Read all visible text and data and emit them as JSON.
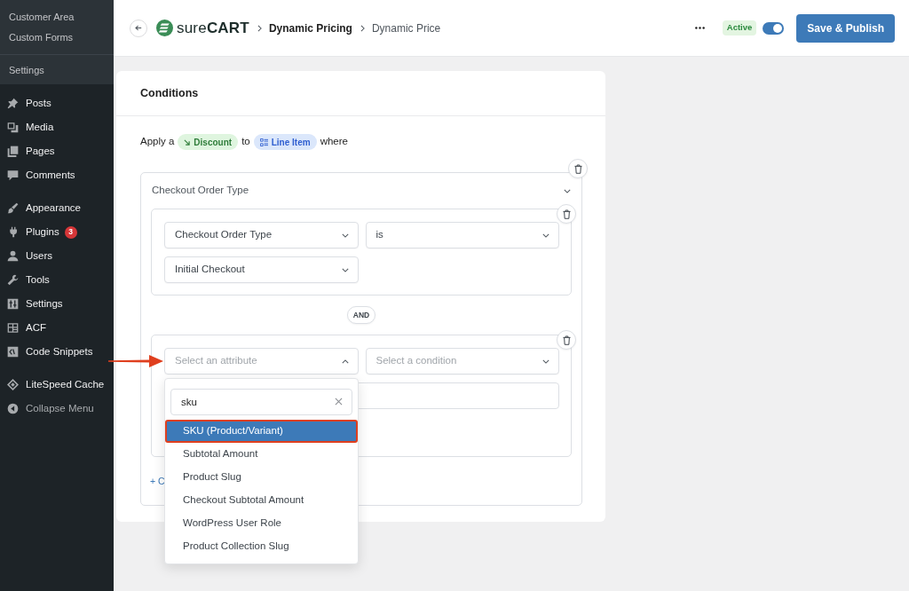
{
  "sidebar": {
    "submenu_groups": [
      {
        "items": [
          {
            "label": "Customer Area"
          },
          {
            "label": "Custom Forms"
          }
        ]
      },
      {
        "items": [
          {
            "label": "Settings"
          }
        ]
      }
    ],
    "menu_groups": [
      {
        "items": [
          {
            "label": "Posts"
          },
          {
            "label": "Media"
          },
          {
            "label": "Pages"
          },
          {
            "label": "Comments"
          }
        ]
      },
      {
        "items": [
          {
            "label": "Appearance"
          },
          {
            "label": "Plugins",
            "badge": "3"
          },
          {
            "label": "Users"
          },
          {
            "label": "Tools"
          },
          {
            "label": "Settings"
          },
          {
            "label": "ACF"
          },
          {
            "label": "Code Snippets"
          }
        ]
      },
      {
        "items": [
          {
            "label": "LiteSpeed Cache"
          }
        ]
      }
    ],
    "collapse": "Collapse Menu"
  },
  "header": {
    "logo": "sure**CART**",
    "breadcrumbs": [
      {
        "label": "Dynamic Pricing",
        "current": false
      },
      {
        "label": "Dynamic Price",
        "current": true
      }
    ],
    "status": "Active",
    "toggle_on": true,
    "save_button": "Save & Publish"
  },
  "conditions": {
    "title": "Conditions",
    "intro": {
      "before": "Apply a",
      "action": "Discount",
      "middle": "to",
      "target": "Line Item",
      "after": "where"
    },
    "groups": [
      {
        "title": "Checkout Order Type",
        "expanded": true,
        "joiners": [
          "AND"
        ],
        "add_link": "+ C",
        "rules": [
          {
            "attribute": {
              "value": "Checkout Order Type",
              "open": false,
              "annotated": false
            },
            "operator": {
              "value": "is"
            },
            "value": {
              "kind": "select",
              "value": "Initial Checkout"
            }
          },
          {
            "attribute": {
              "placeholder": "Select an attribute",
              "open": true,
              "annotated": true,
              "search": "sku",
              "options": [
                {
                  "label": "SKU (Product/Variant)",
                  "selected": true,
                  "outlined": true
                },
                {
                  "label": "Subtotal Amount",
                  "selected": false,
                  "outlined": false
                },
                {
                  "label": "Product Slug",
                  "selected": false,
                  "outlined": false
                },
                {
                  "label": "Checkout Subtotal Amount",
                  "selected": false,
                  "outlined": false
                },
                {
                  "label": "WordPress User Role",
                  "selected": false,
                  "outlined": false
                },
                {
                  "label": "Product Collection Slug",
                  "selected": false,
                  "outlined": false
                }
              ]
            },
            "operator": {
              "placeholder": "Select a condition"
            },
            "value": {
              "kind": "input"
            }
          }
        ]
      }
    ]
  }
}
